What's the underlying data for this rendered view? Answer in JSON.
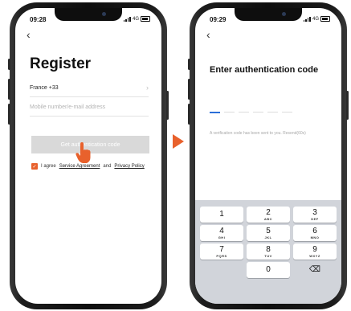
{
  "register_screen": {
    "status_time": "09:28",
    "network": "4G",
    "back_glyph": "‹",
    "title": "Register",
    "country_value": "France +33",
    "chevron_glyph": "›",
    "phone_placeholder": "Mobile number/e-mail address",
    "get_code_label": "Get authentication code",
    "agree_prefix": "I agree",
    "service_agreement": "Service Agreement",
    "and": "and",
    "privacy_policy": "Privacy Policy",
    "checkbox_glyph": "✓",
    "accent_color": "#e8612c",
    "pointer_icon": "hand-pointer-icon"
  },
  "arrow_icon": "play-arrow-icon",
  "auth_screen": {
    "status_time": "09:29",
    "network": "4G",
    "back_glyph": "‹",
    "title": "Enter authentication code",
    "code_note": "A verification code has been sent to you. Resend(60s)",
    "keypad": {
      "keys": [
        {
          "digit": "1",
          "letters": ""
        },
        {
          "digit": "2",
          "letters": "ABC"
        },
        {
          "digit": "3",
          "letters": "DEF"
        },
        {
          "digit": "4",
          "letters": "GHI"
        },
        {
          "digit": "5",
          "letters": "JKL"
        },
        {
          "digit": "6",
          "letters": "MNO"
        },
        {
          "digit": "7",
          "letters": "PQRS"
        },
        {
          "digit": "8",
          "letters": "TUV"
        },
        {
          "digit": "9",
          "letters": "WXYZ"
        },
        {
          "digit": "0",
          "letters": ""
        }
      ],
      "delete_glyph": "⌫"
    }
  }
}
